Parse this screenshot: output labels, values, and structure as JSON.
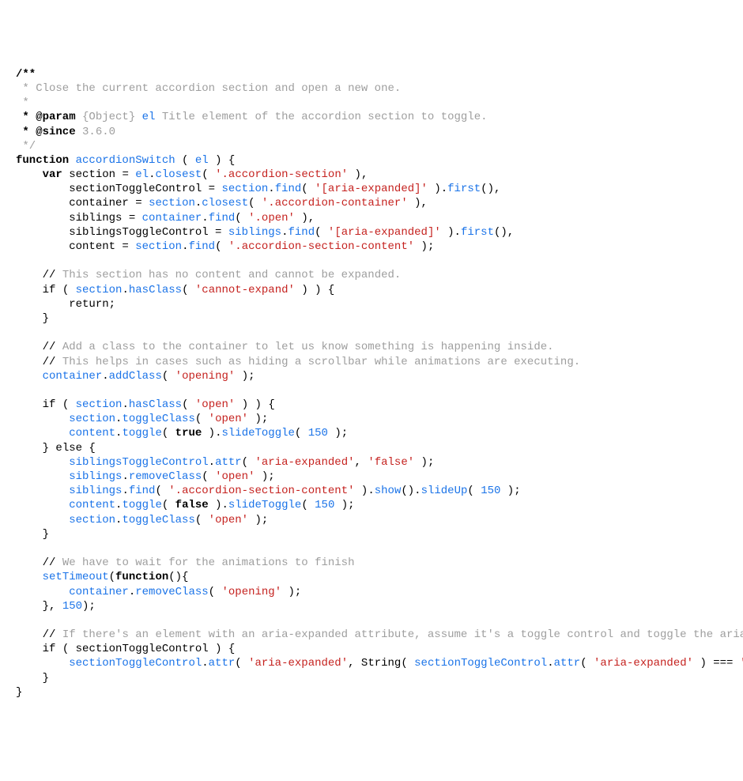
{
  "doc": {
    "open": "/**",
    "line1": " * Close the current accordion section and open a new one.",
    "blank": " *",
    "paramTag": " * @param",
    "paramType": " {Object} ",
    "paramName": "el",
    "paramDesc": " Title element of the accordion section to toggle.",
    "sinceTag": " * @since",
    "sinceVal": " 3.6.0",
    "close": " */"
  },
  "kw": {
    "function": "function",
    "var": "var",
    "if": "if",
    "return": "return;",
    "else": "else",
    "setTimeout": "setTimeout",
    "true": "true",
    "false": "false"
  },
  "fn": {
    "name": "accordionSwitch",
    "paramEl": "el"
  },
  "ids": {
    "section": "section",
    "sectionToggleControl": "sectionToggleControl",
    "container": "container",
    "siblings": "siblings",
    "siblingsToggleControl": "siblingsToggleControl",
    "content": "content",
    "String": "String"
  },
  "methods": {
    "closest": "closest",
    "find": "find",
    "first": "first",
    "hasClass": "hasClass",
    "addClass": "addClass",
    "toggleClass": "toggleClass",
    "toggle": "toggle",
    "slideToggle": "slideToggle",
    "attr": "attr",
    "removeClass": "removeClass",
    "show": "show",
    "slideUp": "slideUp"
  },
  "strings": {
    "accordionSection": "'.accordion-section'",
    "ariaExpandedSel": "'[aria-expanded]'",
    "accordionContainer": "'.accordion-container'",
    "open": "'.open'",
    "accordionSectionContent": "'.accordion-section-content'",
    "cannotExpand": "'cannot-expand'",
    "opening": "'opening'",
    "openClass": "'open'",
    "ariaExpanded": "'aria-expanded'",
    "falseStr": "'false'"
  },
  "nums": {
    "n150": "150"
  },
  "comments": {
    "c1": "// ",
    "c1txt": "This section has no content and cannot be expanded.",
    "c2txt": "Add a class to the container to let us know something is happening inside.",
    "c3txt": "This helps in cases such as hiding a scrollbar while animations are executing.",
    "c4txt": "We have to wait for the animations to finish",
    "c5txt": "If there's an element with an aria-expanded attribute, assume it's a toggle control and toggle the aria-expanded value."
  },
  "punct": {
    "sp": " ",
    "lparen": "(",
    "rparen": ")",
    "lbrace": "{",
    "rbrace": "}",
    "semi": ";",
    "comma": ",",
    "dot": ".",
    "eq": " = ",
    "eqeqeq": " === "
  }
}
